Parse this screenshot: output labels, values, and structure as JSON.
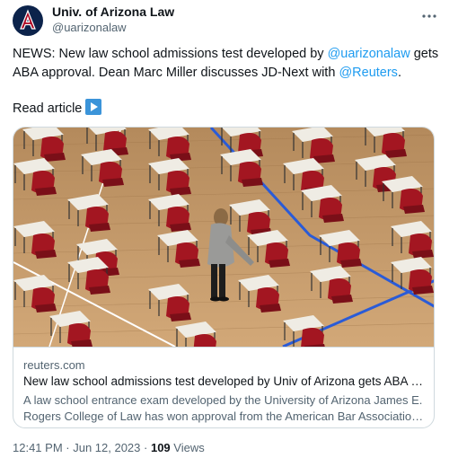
{
  "account": {
    "display_name": "Univ. of Arizona Law",
    "handle": "@uarizonalaw",
    "avatar_letter": "A",
    "avatar_colors": {
      "navy": "#0c234b",
      "red": "#ab0520"
    }
  },
  "tweet": {
    "text_1": "NEWS: New law school admissions test developed by ",
    "mention_1": "@uarizonalaw",
    "text_2": " gets ABA approval. Dean Marc Miller discusses JD-Next with ",
    "mention_2": "@Reuters",
    "text_3": ".",
    "read_article": "Read article",
    "link_color": "#1d9bf0"
  },
  "card": {
    "domain": "reuters.com",
    "title": "New law school admissions test developed by Univ of Arizona gets ABA appr...",
    "desc_line_1": "A law school entrance exam developed by the University of Arizona James E.",
    "desc_line_2": "Rogers College of Law has won approval from the American Bar Association, ..."
  },
  "meta": {
    "time": "12:41 PM",
    "sep_1": " · ",
    "date": "Jun 12, 2023",
    "sep_2": " · ",
    "views_count": "109",
    "views_label": " Views"
  }
}
